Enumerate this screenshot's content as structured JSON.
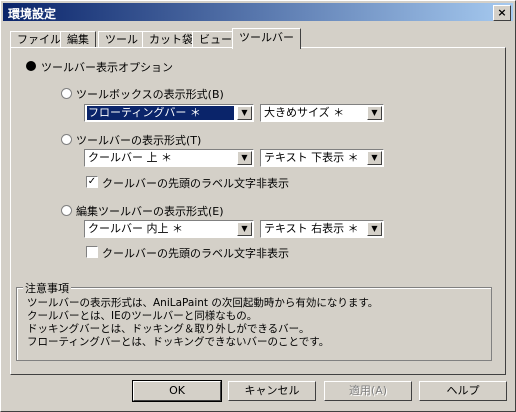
{
  "window": {
    "title": "環境設定",
    "close": "×"
  },
  "tabs": [
    {
      "label": "ファイル"
    },
    {
      "label": "編集"
    },
    {
      "label": "ツール"
    },
    {
      "label": "カット袋"
    },
    {
      "label": "ビュー"
    },
    {
      "label": "ツールバー"
    }
  ],
  "section": {
    "label": "ツールバー表示オプション"
  },
  "toolbox": {
    "label": "ツールボックスの表示形式(B)",
    "combo1": "フローティングバー ＊",
    "combo2": "大きめサイズ ＊"
  },
  "toolbar": {
    "label": "ツールバーの表示形式(T)",
    "combo1": "クールバー 上 ＊",
    "combo2": "テキスト 下表示 ＊",
    "check_label": "クールバーの先頭のラベル文字非表示",
    "checked": true
  },
  "edit_toolbar": {
    "label": "編集ツールバーの表示形式(E)",
    "combo1": "クールバー 内上 ＊",
    "combo2": "テキスト 右表示 ＊",
    "check_label": "クールバーの先頭のラベル文字非表示",
    "checked": false
  },
  "notes": {
    "title": "注意事項",
    "lines": [
      "ツールバーの表示形式は、AniLaPaint の次回起動時から有効になります。",
      "クールバーとは、IEのツールバーと同様なもの。",
      "ドッキングバーとは、ドッキング＆取り外しができるバー。",
      "フローティングバーとは、ドッキングできないバーのことです。"
    ]
  },
  "buttons": {
    "ok": "OK",
    "cancel": "キャンセル",
    "apply": "適用(A)",
    "help": "ヘルプ"
  }
}
